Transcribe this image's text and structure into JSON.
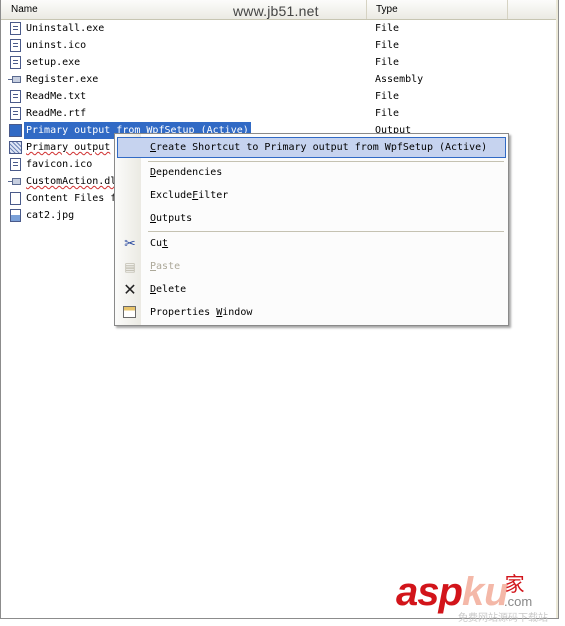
{
  "header": {
    "col_name": "Name",
    "col_type": "Type",
    "watermark": "www.jb51.net"
  },
  "rows": [
    {
      "name": "Uninstall.exe",
      "type": "File",
      "icon": "file-icon"
    },
    {
      "name": "uninst.ico",
      "type": "File",
      "icon": "file-icon"
    },
    {
      "name": "setup.exe",
      "type": "File",
      "icon": "file-icon"
    },
    {
      "name": "Register.exe",
      "type": "Assembly",
      "icon": "assembly-icon"
    },
    {
      "name": "ReadMe.txt",
      "type": "File",
      "icon": "file-icon"
    },
    {
      "name": "ReadMe.rtf",
      "type": "File",
      "icon": "file-icon"
    },
    {
      "name": "Primary output from WpfSetup (Active)",
      "type": "Output",
      "icon": "project-output-icon",
      "selected": true
    },
    {
      "name": "Primary output",
      "type": "",
      "icon": "project-output-icon"
    },
    {
      "name": "favicon.ico",
      "type": "",
      "icon": "file-icon"
    },
    {
      "name": "CustomAction.dl",
      "type": "",
      "icon": "assembly-icon"
    },
    {
      "name": "Content Files f",
      "type": "",
      "icon": "content-files-icon"
    },
    {
      "name": "cat2.jpg",
      "type": "",
      "icon": "image-file-icon"
    }
  ],
  "context_menu": {
    "items": [
      {
        "label": "Create Shortcut to Primary output from WpfSetup (Active)",
        "mnemonic": "C"
      },
      {
        "label": "Dependencies",
        "mnemonic": "D"
      },
      {
        "label": "ExcludeFilter",
        "mnemonic": "F"
      },
      {
        "label": "Outputs",
        "mnemonic": "O"
      },
      {
        "label": "Cut",
        "mnemonic": "t",
        "icon": "scissors-icon"
      },
      {
        "label": "Paste",
        "mnemonic": "P",
        "icon": "paste-icon",
        "disabled": true
      },
      {
        "label": "Delete",
        "mnemonic": "D",
        "icon": "delete-icon"
      },
      {
        "label": "Properties Window",
        "mnemonic": "W",
        "icon": "properties-icon"
      }
    ]
  },
  "logo": {
    "asp": "asp",
    "ku": "ku",
    "jia": "家",
    "com": ".com",
    "sub": "免费网站源码下载站"
  }
}
